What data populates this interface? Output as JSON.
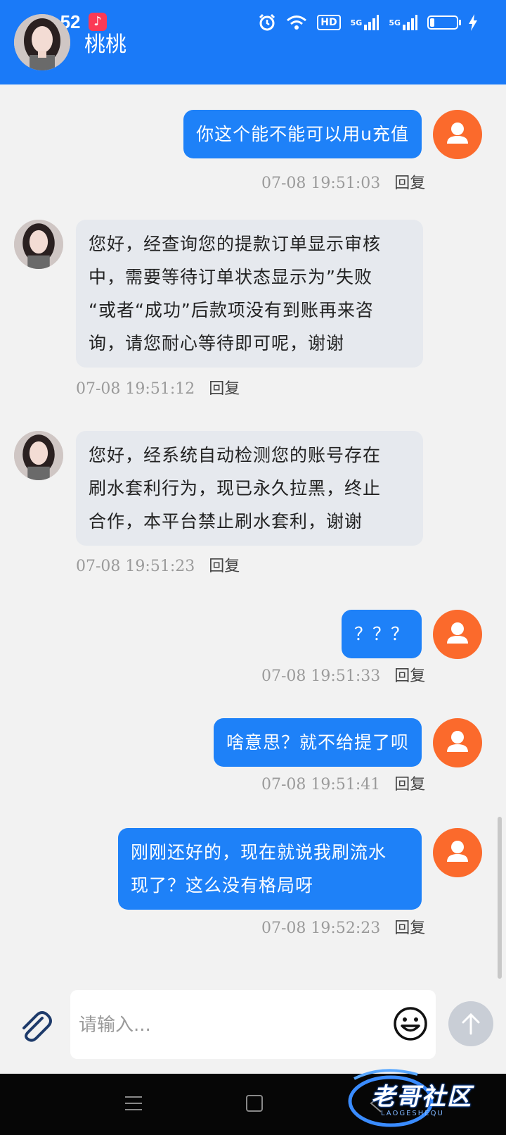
{
  "status_bar": {
    "time": "19:52",
    "hd_label": "HD",
    "net1": "5G",
    "net2": "5G"
  },
  "header": {
    "title": "桃桃"
  },
  "messages": [
    {
      "side": "out",
      "lines": [
        "你这个能不能可以用u充值"
      ],
      "time": "07-08 19:51:03",
      "reply": "回复"
    },
    {
      "side": "in",
      "lines": [
        "您好，经查询您的提款订单显示审核",
        "中，需要等待订单状态显示为”失败",
        "“或者“成功”后款项没有到账再来咨",
        "询，请您耐心等待即可呢，谢谢"
      ],
      "time": "07-08 19:51:12",
      "reply": "回复"
    },
    {
      "side": "in",
      "lines": [
        "您好，经系统自动检测您的账号存在",
        "刷水套利行为，现已永久拉黑，终止",
        "合作，本平台禁止刷水套利，谢谢"
      ],
      "time": "07-08 19:51:23",
      "reply": "回复"
    },
    {
      "side": "out",
      "lines": [
        "？？？"
      ],
      "time": "07-08 19:51:33",
      "reply": "回复"
    },
    {
      "side": "out",
      "lines": [
        "啥意思？就不给提了呗"
      ],
      "time": "07-08 19:51:41",
      "reply": "回复"
    },
    {
      "side": "out",
      "lines": [
        "刚刚还好的，现在就说我刷流水",
        "现了？这么没有格局呀"
      ],
      "time": "07-08 19:52:23",
      "reply": "回复"
    }
  ],
  "input": {
    "placeholder": "请输入...",
    "value": ""
  },
  "watermark": {
    "text": "老哥社区",
    "sub": "LAOGESHEQU"
  },
  "colors": {
    "header_bg": "#1a7af8",
    "bubble_out": "#1e81f8",
    "bubble_in": "#e6e9ee",
    "my_avatar": "#fb6a2c"
  }
}
